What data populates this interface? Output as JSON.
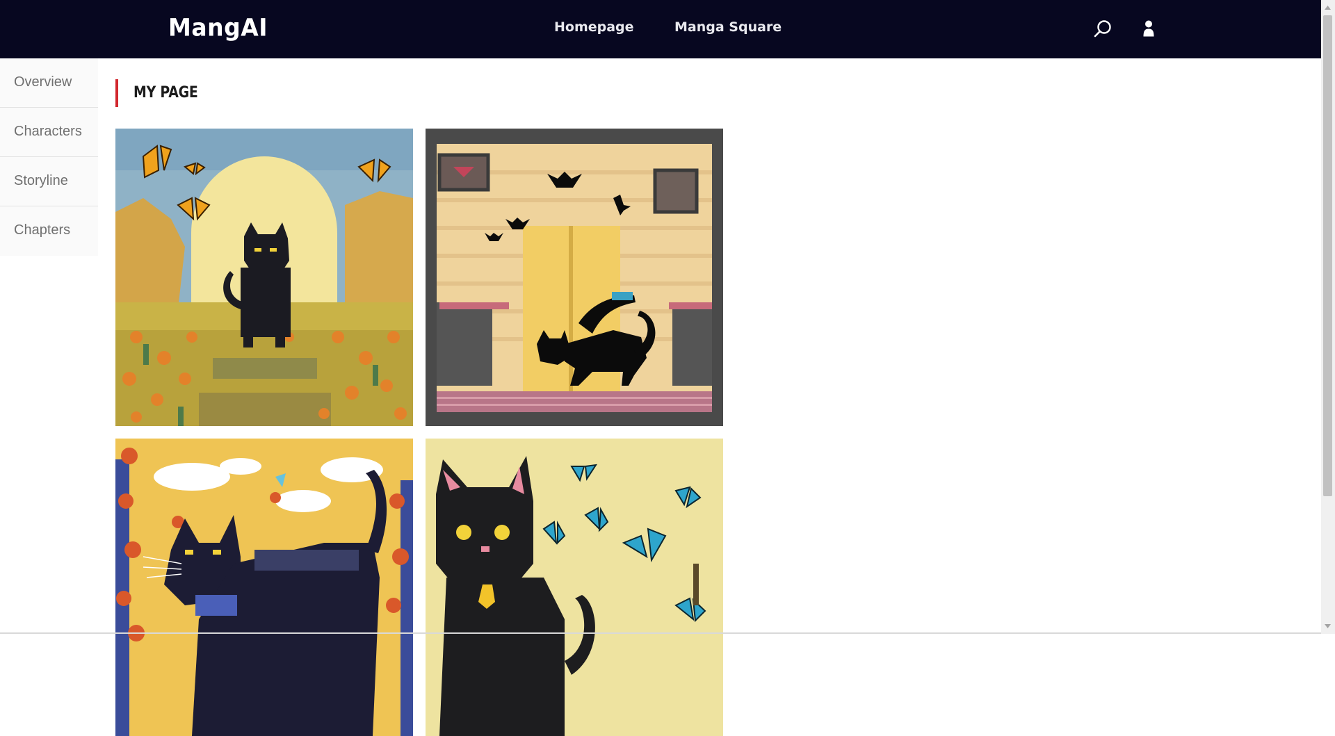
{
  "header": {
    "logo": "MangAI",
    "nav": [
      {
        "label": "Homepage"
      },
      {
        "label": "Manga Square"
      }
    ],
    "icons": [
      "search-icon",
      "user-icon"
    ]
  },
  "sidebar": {
    "items": [
      {
        "label": "Overview"
      },
      {
        "label": "Characters"
      },
      {
        "label": "Storyline"
      },
      {
        "label": "Chapters"
      }
    ]
  },
  "main": {
    "title": "MY PAGE",
    "accent_color": "#d2272e",
    "gallery": [
      {
        "subject": "black cat in flower field with butterflies"
      },
      {
        "subject": "black cat walking in room with bats"
      },
      {
        "subject": "black cat with flowers and clouds"
      },
      {
        "subject": "black cat with blue butterflies"
      }
    ]
  },
  "colors": {
    "header_bg": "#070720",
    "sidebar_bg": "#fafafa",
    "text_muted": "#707070"
  }
}
